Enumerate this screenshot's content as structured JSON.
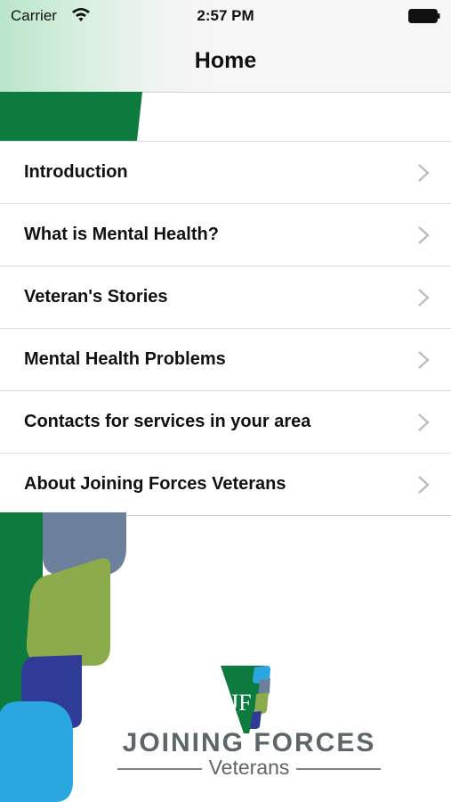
{
  "status_bar": {
    "carrier": "Carrier",
    "time": "2:57 PM"
  },
  "nav": {
    "title": "Home"
  },
  "menu": {
    "items": [
      {
        "label": "Introduction"
      },
      {
        "label": "What is Mental Health?"
      },
      {
        "label": "Veteran's Stories"
      },
      {
        "label": "Mental Health Problems"
      },
      {
        "label": "Contacts for services in your area"
      },
      {
        "label": "About Joining Forces Veterans"
      }
    ]
  },
  "logo": {
    "title": "JOINING FORCES",
    "subtitle": "Veterans",
    "monogram": "JF"
  },
  "colors": {
    "green": "#0d7a3e",
    "slate": "#6c7f9c",
    "olive": "#8cab4a",
    "navy": "#2f3b97",
    "sky": "#2aa6e0"
  }
}
